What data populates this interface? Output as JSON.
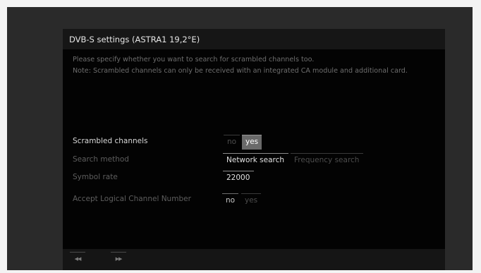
{
  "dialog": {
    "title": "DVB-S settings (ASTRA1 19,2°E)",
    "description_line1": "Please specify whether you want to search for scrambled channels too.",
    "description_line2": "Note: Scrambled channels can only be received with an integrated CA module and additional card."
  },
  "settings": {
    "scrambled": {
      "label": "Scrambled channels",
      "options": [
        "no",
        "yes"
      ],
      "selected": "yes"
    },
    "search_method": {
      "label": "Search method",
      "options": [
        "Network search",
        "Frequency search"
      ],
      "selected": "Network search"
    },
    "symbol_rate": {
      "label": "Symbol rate",
      "value": "22000"
    },
    "lcn": {
      "label": "Accept Logical Channel Number",
      "options": [
        "no",
        "yes"
      ],
      "selected": "no"
    }
  },
  "footer": {
    "back_icon": "rewind-icon",
    "forward_icon": "fast-forward-icon",
    "back_glyph": "◀◀",
    "forward_glyph": "▶▶"
  }
}
